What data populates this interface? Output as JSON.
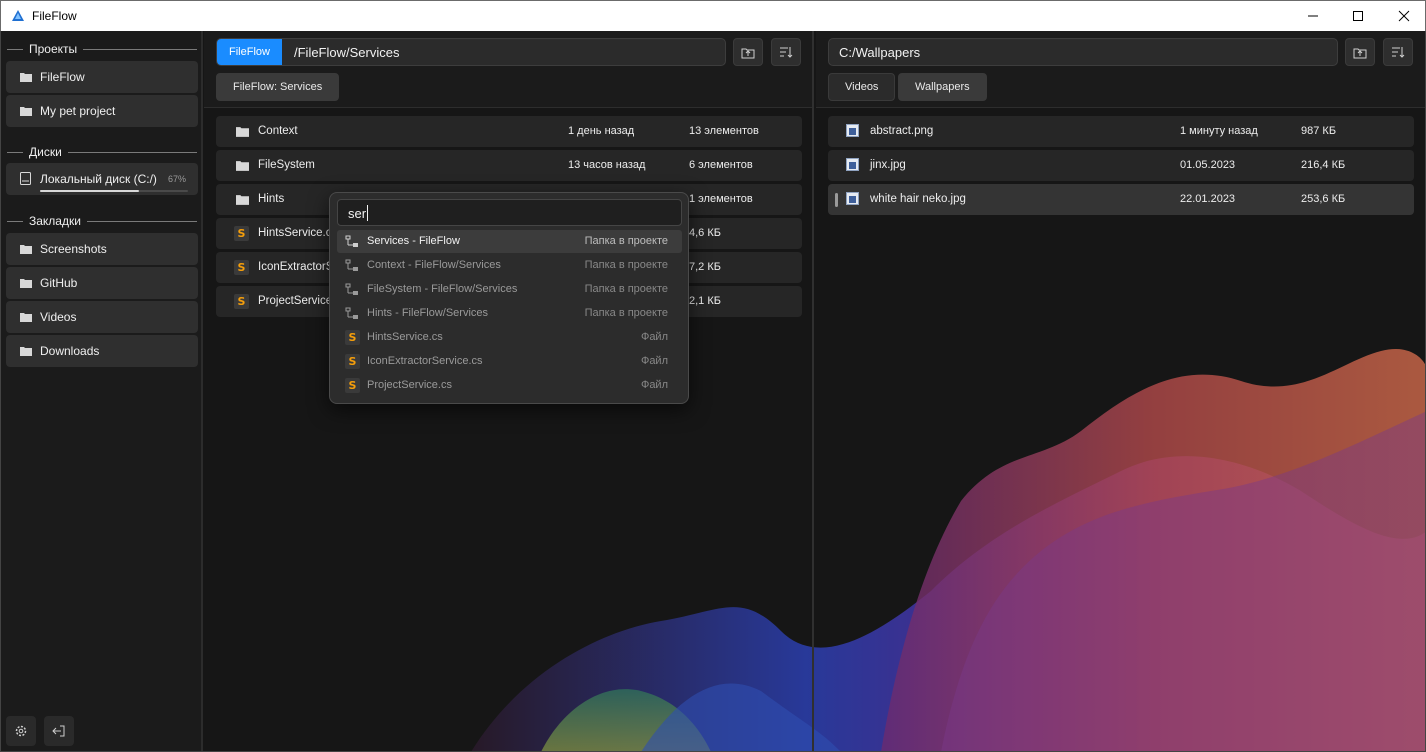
{
  "window": {
    "title": "FileFlow"
  },
  "sidebar": {
    "projects_header": "Проекты",
    "projects": [
      {
        "label": "FileFlow"
      },
      {
        "label": "My pet project"
      }
    ],
    "drives_header": "Диски",
    "drive": {
      "label": "Локальный диск (C:/)",
      "usage_text": "67%",
      "usage": 0.67
    },
    "bookmarks_header": "Закладки",
    "bookmarks": [
      {
        "label": "Screenshots"
      },
      {
        "label": "GitHub"
      },
      {
        "label": "Videos"
      },
      {
        "label": "Downloads"
      }
    ]
  },
  "left_panel": {
    "path_badge": "FileFlow",
    "path": "/FileFlow/Services",
    "tabs": [
      {
        "label": "FileFlow: Services"
      }
    ],
    "rows": [
      {
        "icon": "folder-icon",
        "name": "Context",
        "date": "1 день назад",
        "size": "13 элементов"
      },
      {
        "icon": "folder-icon",
        "name": "FileSystem",
        "date": "13 часов назад",
        "size": "6 элементов"
      },
      {
        "icon": "folder-icon",
        "name": "Hints",
        "date": "",
        "size": "1 элементов"
      },
      {
        "icon": "cs-file-icon",
        "name": "HintsService.cs",
        "date": "",
        "size": "4,6 КБ"
      },
      {
        "icon": "cs-file-icon",
        "name": "IconExtractorSe",
        "date": "",
        "size": "7,2 КБ"
      },
      {
        "icon": "cs-file-icon",
        "name": "ProjectService.",
        "date": "",
        "size": "2,1 КБ"
      }
    ]
  },
  "right_panel": {
    "path": "C:/Wallpapers",
    "tabs": [
      {
        "label": "Videos"
      },
      {
        "label": "Wallpapers"
      }
    ],
    "rows": [
      {
        "icon": "image-file-icon",
        "name": "abstract.png",
        "date": "1 минуту назад",
        "size": "987 КБ"
      },
      {
        "icon": "image-file-icon",
        "name": "jinx.jpg",
        "date": "01.05.2023",
        "size": "216,4 КБ"
      },
      {
        "icon": "image-file-icon",
        "name": "white hair neko.jpg",
        "date": "22.01.2023",
        "size": "253,6 КБ"
      }
    ]
  },
  "search_popup": {
    "query": "ser",
    "results": [
      {
        "icon": "project-folder-icon",
        "title": "Services - FileFlow",
        "kind": "Папка в проекте"
      },
      {
        "icon": "project-folder-icon",
        "title": "Context - FileFlow/Services",
        "kind": "Папка в проекте"
      },
      {
        "icon": "project-folder-icon",
        "title": "FileSystem - FileFlow/Services",
        "kind": "Папка в проекте"
      },
      {
        "icon": "project-folder-icon",
        "title": "Hints - FileFlow/Services",
        "kind": "Папка в проекте"
      },
      {
        "icon": "cs-file-icon",
        "title": "HintsService.cs",
        "kind": "Файл"
      },
      {
        "icon": "cs-file-icon",
        "title": "IconExtractorService.cs",
        "kind": "Файл"
      },
      {
        "icon": "cs-file-icon",
        "title": "ProjectService.cs",
        "kind": "Файл"
      }
    ]
  },
  "colors": {
    "accent": "#1a8cff",
    "cs_icon": "#f59e0b"
  }
}
